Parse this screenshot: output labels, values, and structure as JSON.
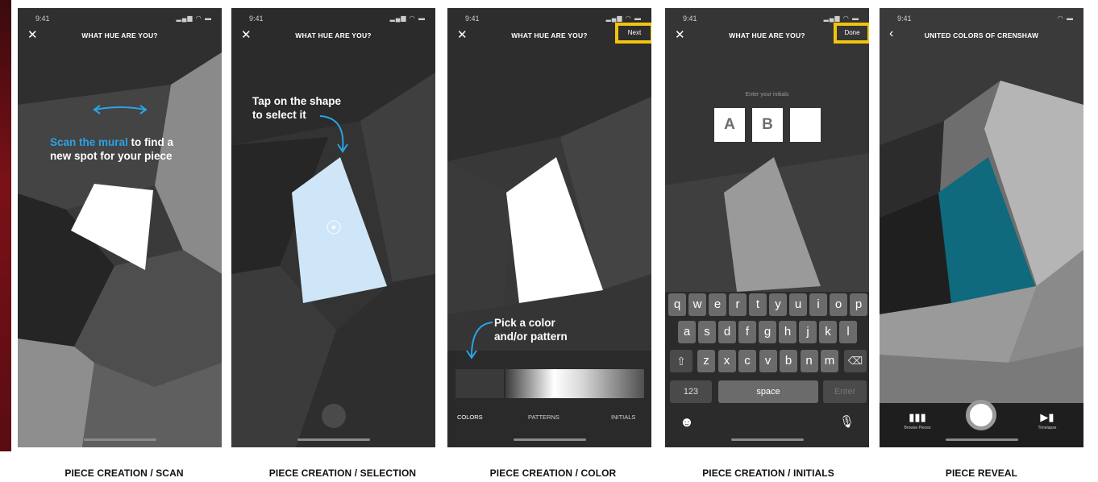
{
  "screens": [
    {
      "status_time": "9:41",
      "title": "WHAT HUE ARE YOU?",
      "instruction_highlight": "Scan the mural",
      "instruction_rest": " to find a",
      "instruction_line2": "new spot for your piece",
      "caption": "PIECE CREATION / SCAN"
    },
    {
      "status_time": "9:41",
      "title": "WHAT HUE ARE YOU?",
      "instruction_line1": "Tap on the shape",
      "instruction_line2": "to select it",
      "caption": "PIECE CREATION / SELECTION"
    },
    {
      "status_time": "9:41",
      "title": "WHAT HUE ARE YOU?",
      "next_label": "Next",
      "instruction_line1": "Pick a color",
      "instruction_line2": "and/or pattern",
      "tabs": [
        "COLORS",
        "PATTERNS",
        "INITIALS"
      ],
      "caption": "PIECE CREATION / COLOR"
    },
    {
      "status_time": "9:41",
      "title": "WHAT HUE ARE YOU?",
      "done_label": "Done",
      "prompt": "Enter your initials",
      "initials": [
        "A",
        "B",
        ""
      ],
      "keyboard": {
        "row1": [
          "q",
          "w",
          "e",
          "r",
          "t",
          "y",
          "u",
          "i",
          "o",
          "p"
        ],
        "row2": [
          "a",
          "s",
          "d",
          "f",
          "g",
          "h",
          "j",
          "k",
          "l"
        ],
        "row3": [
          "z",
          "x",
          "c",
          "v",
          "b",
          "n",
          "m"
        ],
        "numbers": "123",
        "space": "space",
        "enter": "Enter"
      },
      "caption": "PIECE CREATION / INITIALS"
    },
    {
      "status_time": "9:41",
      "title": "UNITED COLORS OF CRENSHAW",
      "browse_label": "Browse Pieces",
      "timelapse_label": "Timelapse",
      "caption": "PIECE REVEAL"
    }
  ],
  "colors": {
    "highlight_box": "#f1c40f",
    "instruction_blue": "#2aa3e8",
    "selected_shape": "#cfe6f8",
    "revealed_shape": "#0e6a7c"
  }
}
